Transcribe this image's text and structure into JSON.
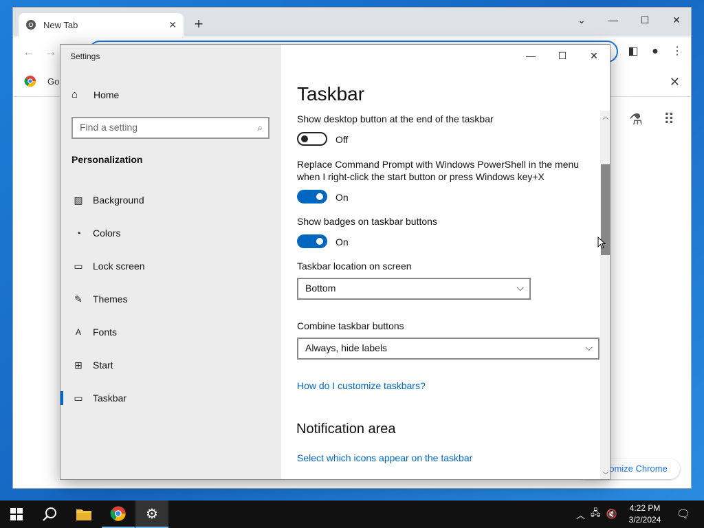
{
  "chrome": {
    "tab_title": "New Tab",
    "bookmark_label": "Go",
    "customize_label": "ıtomize Chrome"
  },
  "settings": {
    "window_title": "Settings",
    "home_label": "Home",
    "search_placeholder": "Find a setting",
    "section_label": "Personalization",
    "nav_items": [
      {
        "label": "Background",
        "icon": "image-icon"
      },
      {
        "label": "Colors",
        "icon": "palette-icon"
      },
      {
        "label": "Lock screen",
        "icon": "lock-screen-icon"
      },
      {
        "label": "Themes",
        "icon": "themes-icon"
      },
      {
        "label": "Fonts",
        "icon": "fonts-icon"
      },
      {
        "label": "Start",
        "icon": "start-icon"
      },
      {
        "label": "Taskbar",
        "icon": "taskbar-icon",
        "active": true
      }
    ],
    "page_title": "Taskbar",
    "content": {
      "show_desktop_label": "Show desktop button at the end of the taskbar",
      "show_desktop_state": "Off",
      "powershell_label": "Replace Command Prompt with Windows PowerShell in the menu when I right-click the start button or press Windows key+X",
      "powershell_state": "On",
      "badges_label": "Show badges on taskbar buttons",
      "badges_state": "On",
      "location_label": "Taskbar location on screen",
      "location_value": "Bottom",
      "combine_label": "Combine taskbar buttons",
      "combine_value": "Always, hide labels",
      "help_link": "How do I customize taskbars?",
      "notification_title": "Notification area",
      "notification_link": "Select which icons appear on the taskbar"
    },
    "accent_color": "#0067c0"
  },
  "taskbar": {
    "time": "4:22 PM",
    "date": "3/2/2024"
  }
}
